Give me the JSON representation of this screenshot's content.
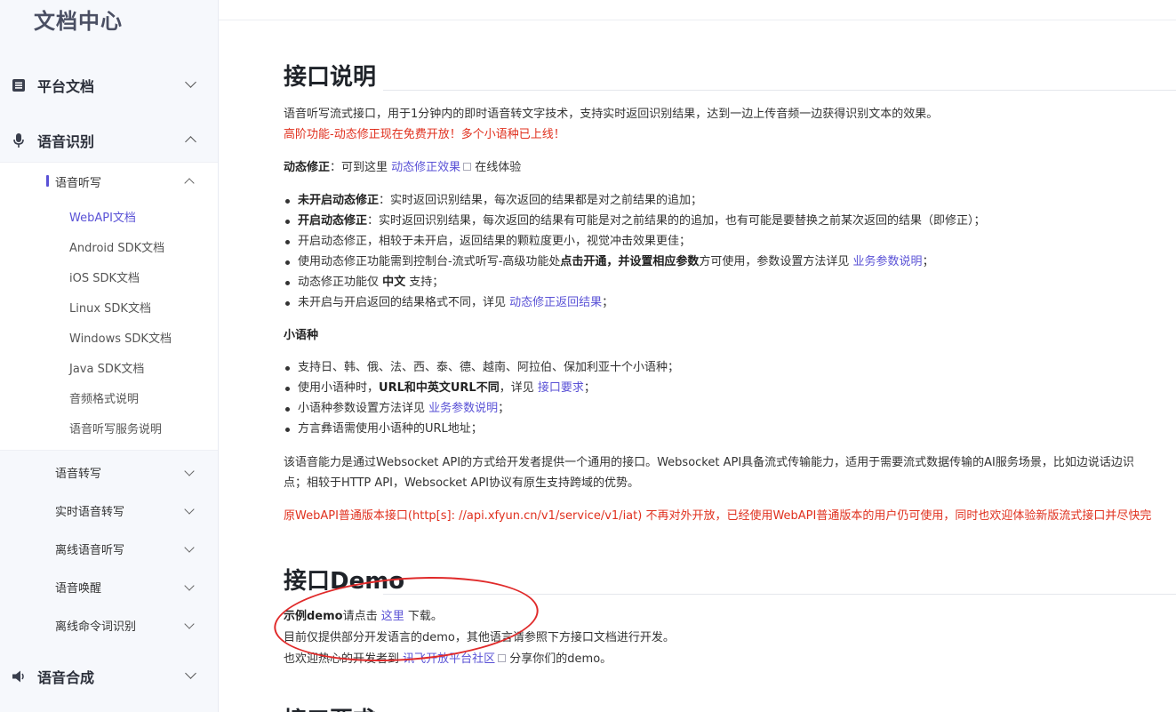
{
  "sidebar": {
    "brand": "文档中心",
    "top_items": [
      {
        "label": "平台文档",
        "icon": "document-list-icon"
      },
      {
        "label": "语音识别",
        "icon": "microphone-icon"
      },
      {
        "label": "语音合成",
        "icon": "speaker-icon"
      }
    ],
    "active_group": "语音听写",
    "leaves": [
      "WebAPI文档",
      "Android SDK文档",
      "iOS SDK文档",
      "Linux SDK文档",
      "Windows SDK文档",
      "Java SDK文档",
      "音频格式说明",
      "语音听写服务说明"
    ],
    "groups": [
      "语音转写",
      "实时语音转写",
      "离线语音听写",
      "语音唤醒",
      "离线命令词识别"
    ]
  },
  "main": {
    "h1_interface": "接口说明",
    "intro": "语音听写流式接口，用于1分钟内的即时语音转文字技术，支持实时返回识别结果，达到一边上传音频一边获得识别文本的效果。",
    "promo": "高阶功能-动态修正现在免费开放！多个小语种已上线！",
    "dyn_label": "动态修正",
    "dyn_text1": "：可到这里 ",
    "dyn_link": "动态修正效果",
    "dyn_text2": " 在线体验",
    "bullets1": {
      "b1_bold": "未开启动态修正",
      "b1_text": "：实时返回识别结果，每次返回的结果都是对之前结果的追加；",
      "b2_bold": "开启动态修正",
      "b2_text": "：实时返回识别结果，每次返回的结果有可能是对之前结果的的追加，也有可能是要替换之前某次返回的结果（即修正）；",
      "b3": "开启动态修正，相较于未开启，返回结果的颗粒度更小，视觉冲击效果更佳；",
      "b4_a": "使用动态修正功能需到控制台-流式听写-高级功能处",
      "b4_bold": "点击开通，并设置相应参数",
      "b4_b": "方可使用，参数设置方法详见 ",
      "b4_link": "业务参数说明",
      "b4_c": "；",
      "b5_a": "动态修正功能仅 ",
      "b5_bold": "中文",
      "b5_b": " 支持；",
      "b6_a": "未开启与开启返回的结果格式不同，详见 ",
      "b6_link": "动态修正返回结果",
      "b6_b": "；"
    },
    "small_lang_title": "小语种",
    "bullets2": {
      "s1": "支持日、韩、俄、法、西、泰、德、越南、阿拉伯、保加利亚十个小语种；",
      "s2_a": "使用小语种时，",
      "s2_bold": "URL和中英文URL不同",
      "s2_b": "，详见 ",
      "s2_link": "接口要求",
      "s2_c": "；",
      "s3_a": "小语种参数设置方法详见 ",
      "s3_link": "业务参数说明",
      "s3_b": "；",
      "s4": "方言彝语需使用小语种的URL地址；"
    },
    "ws_line1": "该语音能力是通过Websocket API的方式给开发者提供一个通用的接口。Websocket API具备流式传输能力，适用于需要流式数据传输的AI服务场景，比如边说话边识",
    "ws_line2": "点；相较于HTTP API，Websocket API协议有原生支持跨域的优势。",
    "old_api_notice": "原WebAPI普通版本接口(http[s]: //api.xfyun.cn/v1/service/v1/iat) 不再对外开放，已经使用WebAPI普通版本的用户仍可使用，同时也欢迎体验新版流式接口并尽快完",
    "h1_demo": "接口Demo",
    "demo_bold": "示例demo",
    "demo_a": "请点击 ",
    "demo_link": "这里",
    "demo_b": " 下载。",
    "demo_line2": "目前仅提供部分开发语言的demo，其他语言请参照下方接口文档进行开发。",
    "demo_line3_a": "也欢迎热心的开发者到 ",
    "demo_line3_link": "讯飞开放平台社区",
    "demo_line3_b": " 分享你们的demo。",
    "h1_next_partial": "接口要求"
  },
  "colors": {
    "accent": "#5a52d6",
    "alert": "#e0301e",
    "annotation_circle": "#e02a2a"
  }
}
